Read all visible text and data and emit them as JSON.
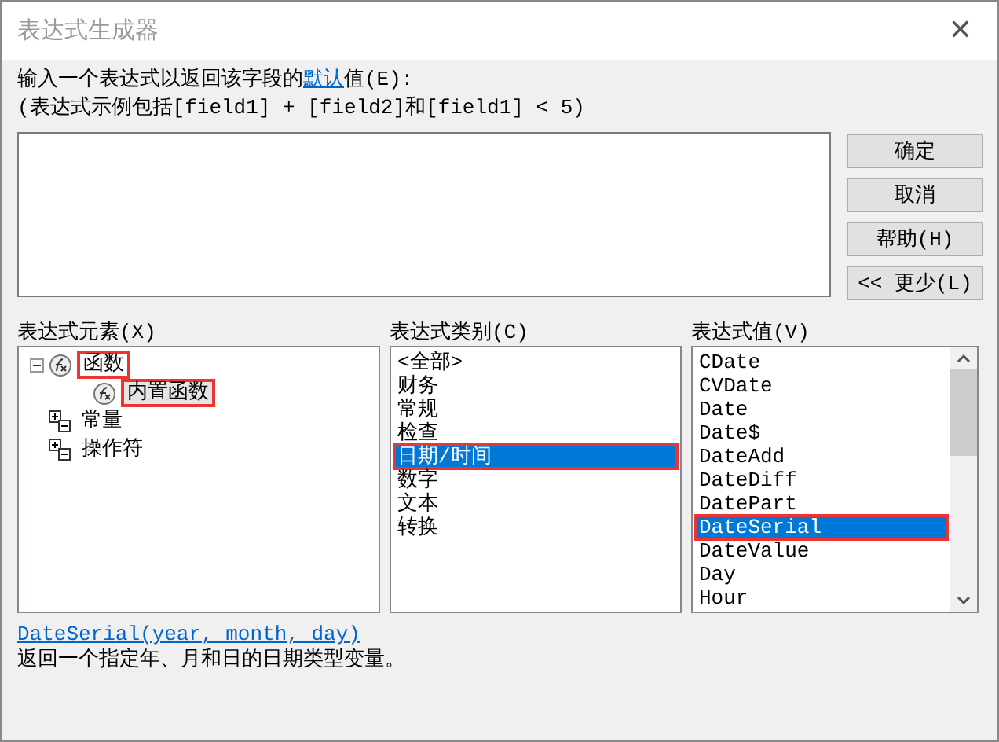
{
  "window": {
    "title": "表达式生成器",
    "close": "✕"
  },
  "prompt": {
    "before": "输入一个表达式以返回该字段的",
    "link": "默认",
    "after": "值(E):"
  },
  "example": "(表达式示例包括[field1] + [field2]和[field1] < 5)",
  "buttons": [
    "确定",
    "取消",
    "帮助(H)",
    "<< 更少(L)"
  ],
  "elements": {
    "label": "表达式元素(X)",
    "items": [
      {
        "label": "函数",
        "kind": "function",
        "expanded": true,
        "selected": false,
        "marked": true,
        "children": [
          {
            "label": "内置函数",
            "kind": "function",
            "selected": true,
            "marked": true
          }
        ]
      },
      {
        "label": "常量",
        "kind": "group",
        "selected": false,
        "marked": false
      },
      {
        "label": "操作符",
        "kind": "group",
        "selected": false,
        "marked": false
      }
    ]
  },
  "categories": {
    "label": "表达式类别(C)",
    "items": [
      {
        "label": "<全部>",
        "selected": false,
        "marked": false
      },
      {
        "label": "财务",
        "selected": false,
        "marked": false
      },
      {
        "label": "常规",
        "selected": false,
        "marked": false
      },
      {
        "label": "检查",
        "selected": false,
        "marked": false
      },
      {
        "label": "日期/时间",
        "selected": true,
        "marked": true
      },
      {
        "label": "数字",
        "selected": false,
        "marked": false
      },
      {
        "label": "文本",
        "selected": false,
        "marked": false
      },
      {
        "label": "转换",
        "selected": false,
        "marked": false
      }
    ]
  },
  "values": {
    "label": "表达式值(V)",
    "items": [
      {
        "label": "CDate",
        "selected": false,
        "marked": false
      },
      {
        "label": "CVDate",
        "selected": false,
        "marked": false
      },
      {
        "label": "Date",
        "selected": false,
        "marked": false
      },
      {
        "label": "Date$",
        "selected": false,
        "marked": false
      },
      {
        "label": "DateAdd",
        "selected": false,
        "marked": false
      },
      {
        "label": "DateDiff",
        "selected": false,
        "marked": false
      },
      {
        "label": "DatePart",
        "selected": false,
        "marked": false
      },
      {
        "label": "DateSerial",
        "selected": true,
        "marked": true
      },
      {
        "label": "DateValue",
        "selected": false,
        "marked": false
      },
      {
        "label": "Day",
        "selected": false,
        "marked": false
      },
      {
        "label": "Hour",
        "selected": false,
        "marked": false
      }
    ]
  },
  "signature": "DateSerial(year, month, day)",
  "description": "返回一个指定年、月和日的日期类型变量。"
}
